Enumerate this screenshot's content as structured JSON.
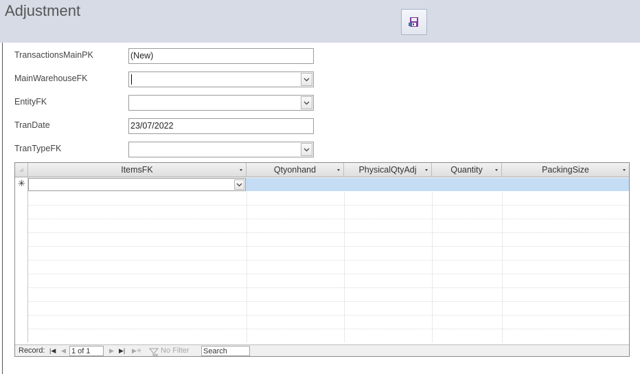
{
  "form": {
    "title": "Adjustment",
    "save_icon": "save-icon"
  },
  "fields": [
    {
      "label": "TransactionsMainPK",
      "value": "(New)",
      "type": "text"
    },
    {
      "label": "MainWarehouseFK",
      "value": "",
      "type": "combo"
    },
    {
      "label": "EntityFK",
      "value": "",
      "type": "combo"
    },
    {
      "label": "TranDate",
      "value": "23/07/2022",
      "type": "text"
    },
    {
      "label": "TranTypeFK",
      "value": "",
      "type": "combo"
    }
  ],
  "grid": {
    "columns": [
      {
        "label": "ItemsFK"
      },
      {
        "label": "Qtyonhand"
      },
      {
        "label": "PhysicalQtyAdj"
      },
      {
        "label": "Quantity"
      },
      {
        "label": "PackingSize"
      }
    ],
    "new_record_marker": "✳",
    "new_row_values": [
      "",
      "",
      "",
      "",
      ""
    ]
  },
  "navigation": {
    "record_label": "Record:",
    "position": "1 of 1",
    "filter_label": "No Filter",
    "search_placeholder": "Search"
  },
  "colors": {
    "header_bg": "#d6dbe5",
    "new_row_highlight": "#c4dcf4"
  }
}
